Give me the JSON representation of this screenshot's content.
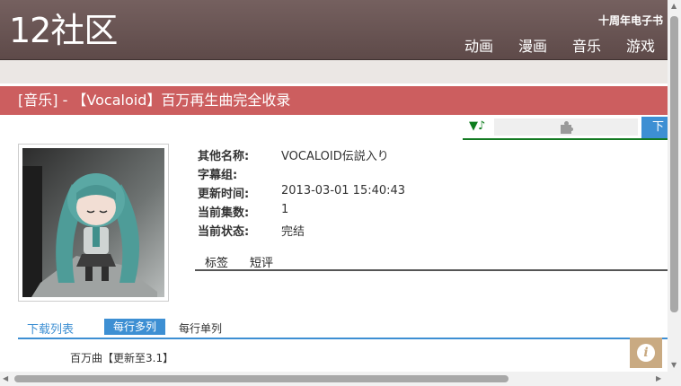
{
  "header": {
    "logo": "12社区",
    "promo": "十周年电子书",
    "nav": [
      "动画",
      "漫画",
      "音乐",
      "游戏"
    ]
  },
  "page": {
    "title": "[音乐] - 【Vocaloid】百万再生曲完全收录"
  },
  "toolbar": {
    "note": "▼♪",
    "plugin_icon": "puzzle-icon",
    "download_label": "下"
  },
  "details": [
    {
      "label": "其他名称:",
      "value": "VOCALOID伝説入り"
    },
    {
      "label": "字幕组:",
      "value": ""
    },
    {
      "label": "更新时间:",
      "value": "2013-03-01 15:40:43"
    },
    {
      "label": "当前集数:",
      "value": "1"
    },
    {
      "label": "当前状态:",
      "value": "完结"
    }
  ],
  "tabs": [
    "标签",
    "短评"
  ],
  "download": {
    "title": "下载列表",
    "multi": "每行多列",
    "single": "每行单列",
    "episode": "百万曲【更新至3.1】"
  },
  "info_icon": "info-icon",
  "colors": {
    "header": "#6b5756",
    "title_bar": "#cc5e5f",
    "accent_blue": "#3d8fd3",
    "accent_green": "#137a22",
    "info_button": "#c9aa82"
  }
}
